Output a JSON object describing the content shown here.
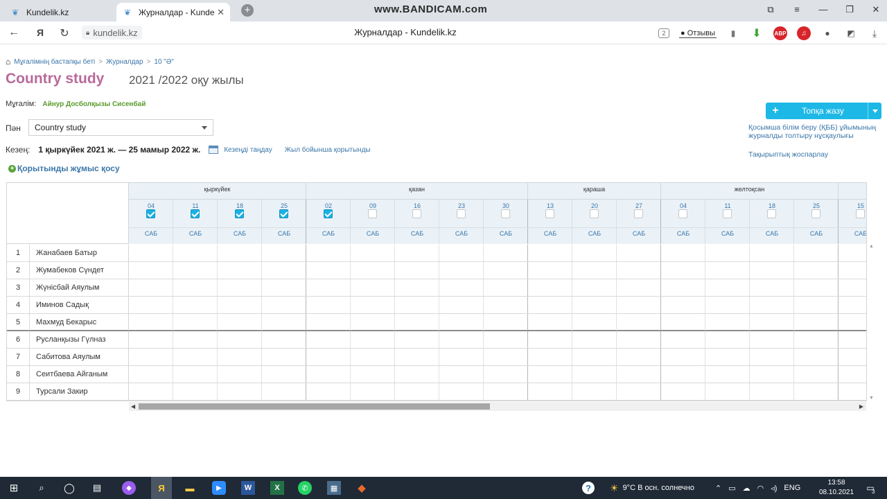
{
  "browser": {
    "tabs": [
      {
        "title": "Kundelik.kz",
        "active": false
      },
      {
        "title": "Журналдар - Kundelik.k",
        "active": true
      }
    ],
    "watermark": "www.BANDICAM.com",
    "url": "kundelik.kz",
    "page_caption": "Журналдар - Kundelik.kz",
    "feedback_label": "Отзывы",
    "tab_count_badge": "2",
    "abp_label": "ABP"
  },
  "breadcrumb": {
    "items": [
      "Мұғалімнің бастапқы беті",
      "Журналдар",
      "10 \"Ә\""
    ]
  },
  "header": {
    "subject": "Country study",
    "year": "2021 /2022 оқу жылы"
  },
  "teacher": {
    "label": "Мұғалім:",
    "name": "Айнур Досболқызы Сисенбай"
  },
  "subject_select": {
    "label": "Пән",
    "value": "Country study"
  },
  "period": {
    "label": "Кезең:",
    "value": "1 қыркүйек 2021 ж. — 25 мамыр 2022 ж.",
    "choose_link": "Кезеңді таңдау",
    "year_final_link": "Жыл бойынша қорытынды"
  },
  "add_final_work": "Қорытынды жұмыс қосу",
  "group_button": {
    "label": "Топқа жазу"
  },
  "right_links": {
    "instructions": "Қосымша білім беру (ҚББ) ұйымының журналды толтыру нұсқаулығы",
    "thematic_plan": "Тақырыптық жоспарлау"
  },
  "journal": {
    "months": [
      {
        "name": "қыркүйек",
        "span": 4
      },
      {
        "name": "қазан",
        "span": 5
      },
      {
        "name": "қараша",
        "span": 3
      },
      {
        "name": "желтоқсан",
        "span": 4
      },
      {
        "name": "",
        "span": 1
      }
    ],
    "dates": [
      {
        "day": "04",
        "checked": true,
        "type": "САБ"
      },
      {
        "day": "11",
        "checked": true,
        "type": "САБ"
      },
      {
        "day": "18",
        "checked": true,
        "type": "САБ"
      },
      {
        "day": "25",
        "checked": true,
        "type": "САБ"
      },
      {
        "day": "02",
        "checked": true,
        "type": "САБ"
      },
      {
        "day": "09",
        "checked": false,
        "type": "САБ"
      },
      {
        "day": "16",
        "checked": false,
        "type": "САБ"
      },
      {
        "day": "23",
        "checked": false,
        "type": "САБ"
      },
      {
        "day": "30",
        "checked": false,
        "type": "САБ"
      },
      {
        "day": "13",
        "checked": false,
        "type": "САБ"
      },
      {
        "day": "20",
        "checked": false,
        "type": "САБ"
      },
      {
        "day": "27",
        "checked": false,
        "type": "САБ"
      },
      {
        "day": "04",
        "checked": false,
        "type": "САБ"
      },
      {
        "day": "11",
        "checked": false,
        "type": "САБ"
      },
      {
        "day": "18",
        "checked": false,
        "type": "САБ"
      },
      {
        "day": "25",
        "checked": false,
        "type": "САБ"
      },
      {
        "day": "15",
        "checked": false,
        "type": "САБ"
      }
    ],
    "students": [
      {
        "num": "1",
        "name": "Жанабаев Батыр"
      },
      {
        "num": "2",
        "name": "Жумабеков Сүндет"
      },
      {
        "num": "3",
        "name": "Жүнісбай Аяулым"
      },
      {
        "num": "4",
        "name": "Иминов Садық"
      },
      {
        "num": "5",
        "name": "Махмуд Бекарыс"
      },
      {
        "num": "6",
        "name": "Русланқызы Гүлназ"
      },
      {
        "num": "7",
        "name": "Сабитова Аяулым"
      },
      {
        "num": "8",
        "name": "Сеитбаева Айганым"
      },
      {
        "num": "9",
        "name": "Турсали Закир"
      }
    ]
  },
  "taskbar": {
    "weather": "9°C  В осн. солнечно",
    "lang": "ENG",
    "time": "13:58",
    "date": "08.10.2021",
    "notif_count": "3",
    "word_label": "W",
    "excel_label": "X",
    "yandex_label": "Я"
  },
  "colors": {
    "accent": "#1db8e6",
    "subject_title": "#b86a9a",
    "teacher_name": "#5a9b2e",
    "link": "#3b76a8"
  }
}
